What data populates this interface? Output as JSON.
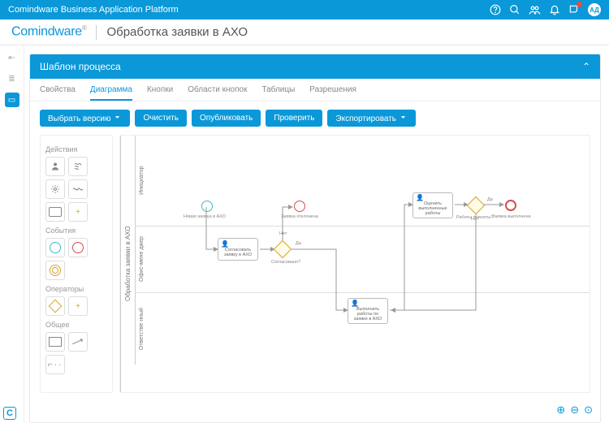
{
  "topbar": {
    "title": "Comindware Business Application Platform",
    "avatar": "АД"
  },
  "logo": {
    "brand": "Comindware",
    "suffix": "®"
  },
  "page": {
    "title": "Обработка заявки в АХО"
  },
  "card": {
    "title": "Шаблон процесса"
  },
  "tabs": [
    "Свойства",
    "Диаграмма",
    "Кнопки",
    "Области кнопок",
    "Таблицы",
    "Разрешения"
  ],
  "active_tab": 1,
  "toolbar": {
    "select_version": "Выбрать версию",
    "clear": "Очистить",
    "publish": "Опубликовать",
    "check": "Проверить",
    "export": "Экспортировать"
  },
  "palette": {
    "actions": "Действия",
    "events": "События",
    "operators": "Операторы",
    "general": "Общее",
    "plus": "+"
  },
  "pool": {
    "label": "Обработка заявки в АХО"
  },
  "lanes": {
    "l1": "Инициатор",
    "l2": "Офис-мене джер",
    "l3": "Ответстве нный"
  },
  "nodes": {
    "start": "Новая заявка в АХО",
    "rejected": "Заявка отклонена",
    "approve": "Согласовать заявку в АХО",
    "approved_q": "Согласовано?",
    "gw_yes": "Да",
    "gw_no": "Нет",
    "do_work": "Выполнить работы по заявке в АХО",
    "rate": "Оценить выполненные работы",
    "accepted_q": "Работы приняты?",
    "done": "Заявка выполнена"
  }
}
